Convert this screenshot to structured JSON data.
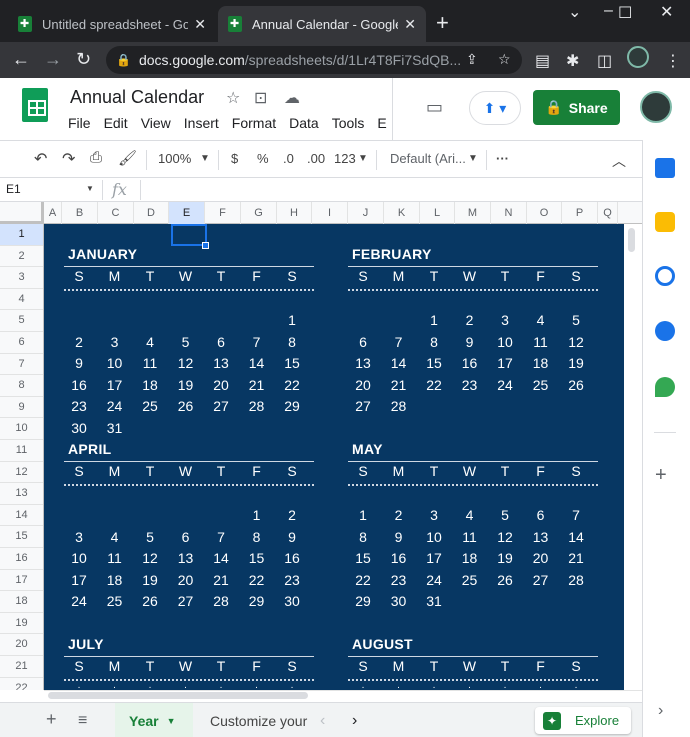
{
  "browser": {
    "tabs": [
      {
        "title": "Untitled spreadsheet - Goog",
        "active": false
      },
      {
        "title": "Annual Calendar - Google S",
        "active": true
      }
    ],
    "url_host": "docs.google.com",
    "url_path": "/spreadsheets/d/1Lr4T8Fi7SdQB..."
  },
  "doc": {
    "title": "Annual Calendar",
    "menus": [
      "File",
      "Edit",
      "View",
      "Insert",
      "Format",
      "Data",
      "Tools",
      "E"
    ],
    "share_label": "Share"
  },
  "toolbar": {
    "zoom": "100%",
    "currency": "$",
    "percent": "%",
    "dec_less": ".0",
    "dec_more": ".00",
    "format_more": "123",
    "font": "Default (Ari..."
  },
  "formula_bar": {
    "cell_ref": "E1",
    "fx": "fx"
  },
  "columns": [
    "A",
    "B",
    "C",
    "D",
    "E",
    "F",
    "G",
    "H",
    "I",
    "J",
    "K",
    "L",
    "M",
    "N",
    "O",
    "P",
    "Q"
  ],
  "selected_column": "E",
  "rows": [
    "1",
    "2",
    "3",
    "4",
    "5",
    "6",
    "7",
    "8",
    "9",
    "10",
    "11",
    "12",
    "13",
    "14",
    "15",
    "16",
    "17",
    "18",
    "19",
    "20",
    "21",
    "22"
  ],
  "weekdays": [
    "S",
    "M",
    "T",
    "W",
    "T",
    "F",
    "S"
  ],
  "months": [
    {
      "name": "JANUARY",
      "start": 6,
      "days": 31
    },
    {
      "name": "FEBRUARY",
      "start": 2,
      "days": 28
    },
    {
      "name": "APRIL",
      "start": 5,
      "days": 30
    },
    {
      "name": "MAY",
      "start": 0,
      "days": 31
    },
    {
      "name": "JULY",
      "start": -1,
      "days": 0
    },
    {
      "name": "AUGUST",
      "start": -1,
      "days": 0
    }
  ],
  "sheet_tabs": {
    "active": "Year",
    "other": "Customize your"
  },
  "explore_label": "Explore",
  "colors": {
    "calendar_bg": "#073763",
    "brand_green": "#188038",
    "selection_blue": "#1a73e8"
  }
}
